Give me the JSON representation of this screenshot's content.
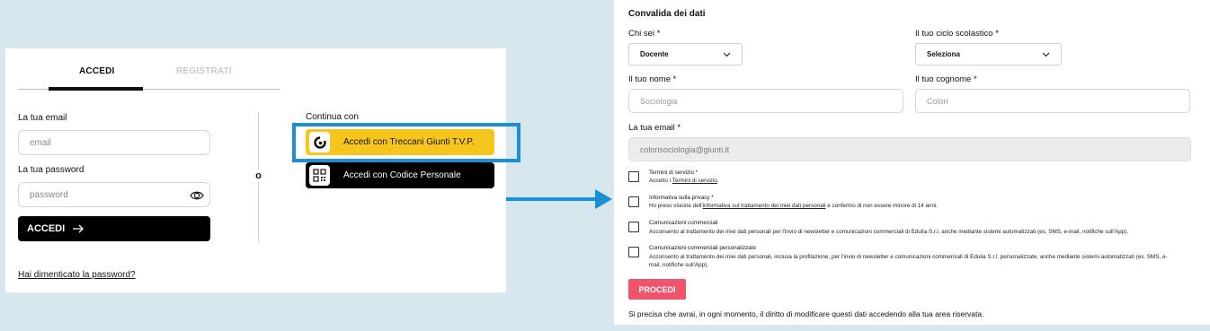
{
  "login": {
    "tabs": {
      "accedi": "ACCEDI",
      "registrati": "REGISTRATI"
    },
    "email_label": "La tua email",
    "email_placeholder": "email",
    "password_label": "La tua password",
    "password_placeholder": "password",
    "submit_label": "ACCEDI",
    "forgot_label": "Hai dimenticato la password?",
    "separator": "o",
    "continue_label": "Continua con",
    "sso_treccani_label": "Accedi con Treccani Giunti T.V.P.",
    "sso_codice_label": "Accedi con Codice Personale"
  },
  "form": {
    "title": "Convalida dei dati",
    "chi_sei_label": "Chi sei *",
    "chi_sei_value": "Docente",
    "ciclo_label": "Il tuo ciclo scolastico *",
    "ciclo_value": "Seleziona",
    "nome_label": "Il tuo nome *",
    "nome_value": "Sociologia",
    "cognome_label": "Il tuo cognome *",
    "cognome_value": "Colori",
    "email_label": "La tua email *",
    "email_value": "colorisociologia@giunti.it",
    "consents": [
      {
        "title": "Termini di servizio *",
        "text_before": "Accetto i ",
        "link": "Termini di servizio",
        "text_after": "."
      },
      {
        "title": "Informativa sulla privacy *",
        "text_before": "Ho preso visione dell'",
        "link": "informativa sul trattamento dei miei dati personali",
        "text_after": " e confermo di non essere minore di 14 anni."
      },
      {
        "title": "Comunicazioni commerciali",
        "text": "Acconsento al trattamento dei miei dati personali per l'invio di newsletter e comunicazioni commerciali di Edulia S.r.l. anche mediante sistemi automatizzati (es. SMS, e-mail, notifiche sull'App)."
      },
      {
        "title": "Comunicazioni commerciali personalizzate",
        "text_line1": "Acconsento al trattamento dei miei dati personali, inclusa la profilazione, per l'invio di newsletter e comunicazioni commerciali di Edulia S.r.l. personalizzate, anche mediante sistemi automatizzati (es. SMS, e-",
        "text_line2": "mail, notifiche sull'App)."
      }
    ],
    "submit_label": "PROCEDI",
    "footnote": "Si precisa che avrai, in ogni momento, il diritto di modificare questi dati accedendo alla tua area riservata."
  },
  "colors": {
    "background": "#d6e8ee",
    "highlight": "#1a8fd6",
    "treccani_yellow": "#f7c61d",
    "procedi_red": "#f0546b"
  },
  "icons": [
    "eye-icon",
    "arrow-right-icon",
    "treccani-logo-icon",
    "qr-code-icon",
    "chevron-down-icon",
    "callout-arrow-icon"
  ]
}
